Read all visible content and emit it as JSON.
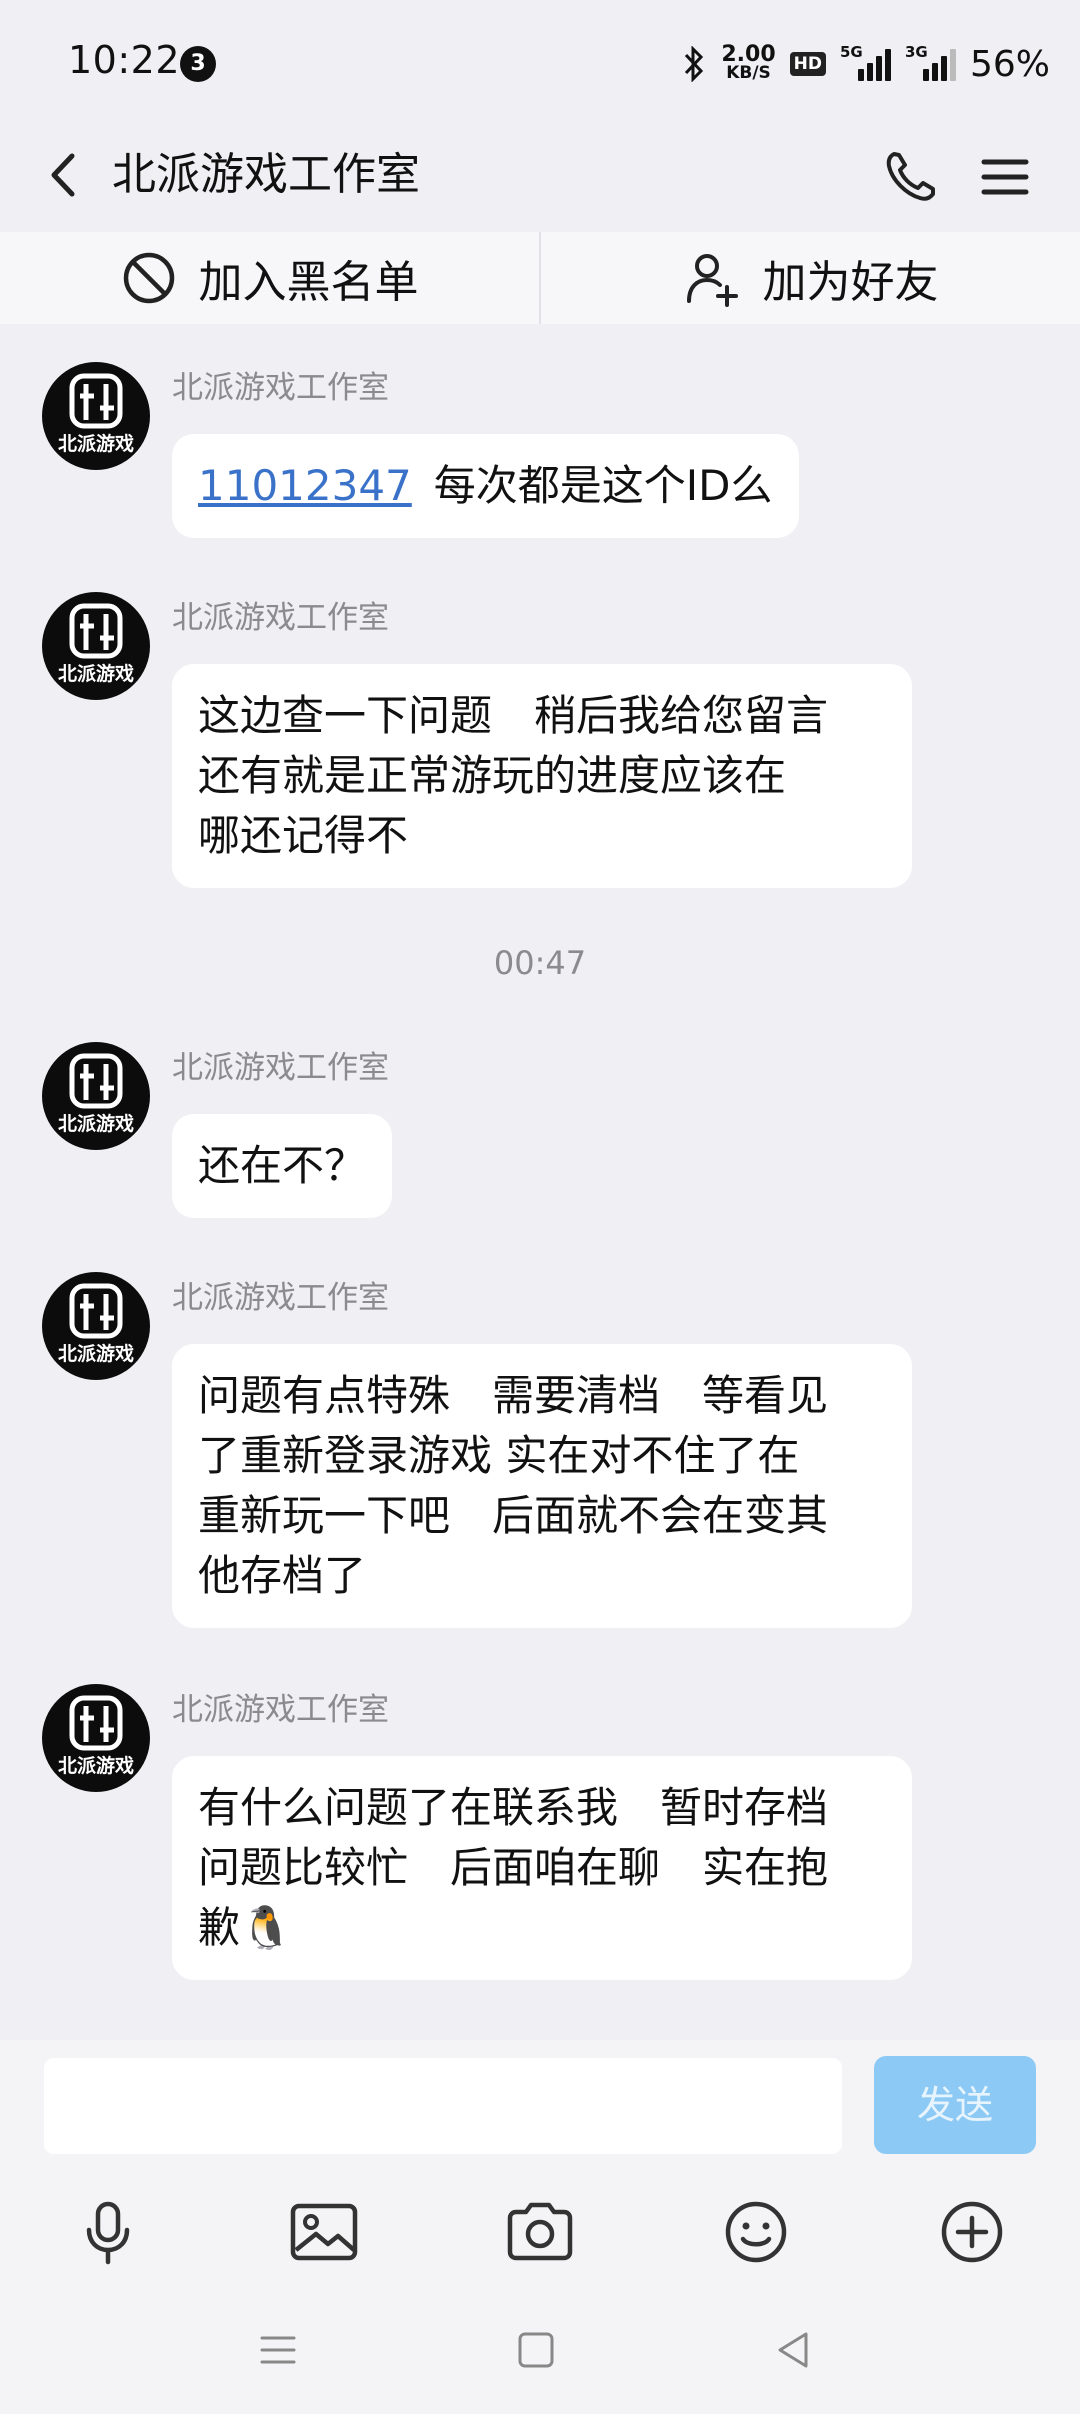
{
  "status_bar": {
    "time": "10:22",
    "notification_count": "3",
    "net_speed": "2.00",
    "net_unit": "KB/S",
    "hd_label": "HD",
    "sig1_label": "5G",
    "sig2_label": "3G",
    "battery": "56%"
  },
  "header": {
    "title": "北派游戏工作室"
  },
  "actions": {
    "block_label": "加入黑名单",
    "add_friend_label": "加为好友"
  },
  "messages": [
    {
      "sender": "北派游戏工作室",
      "link": "11012347",
      "text": "每次都是这个ID么"
    },
    {
      "sender": "北派游戏工作室",
      "lines": [
        "这边查一下问题　稍后我给您留言",
        "还有就是正常游玩的进度应该在",
        "哪还记得不"
      ]
    },
    {
      "sender": "北派游戏工作室",
      "lines": [
        "还在不？"
      ]
    },
    {
      "sender": "北派游戏工作室",
      "lines": [
        "问题有点特殊　需要清档　等看见",
        "了重新登录游戏  实在对不住了在",
        "重新玩一下吧　后面就不会在变其",
        "他存档了"
      ]
    },
    {
      "sender": "北派游戏工作室",
      "lines": [
        "有什么问题了在联系我　暂时存档",
        "问题比较忙　后面咱在聊　实在抱",
        "歉🐧"
      ]
    }
  ],
  "time_separator": "00:47",
  "avatar_text": "北派游戏",
  "input": {
    "placeholder": "",
    "send_label": "发送"
  },
  "colors": {
    "background": "#efeff4",
    "link": "#3b72c9",
    "send_button": "#8ccaf5"
  },
  "icons": [
    "back-arrow-icon",
    "phone-icon",
    "menu-icon",
    "block-icon",
    "add-user-icon",
    "microphone-icon",
    "image-icon",
    "camera-icon",
    "emoji-icon",
    "plus-icon"
  ]
}
